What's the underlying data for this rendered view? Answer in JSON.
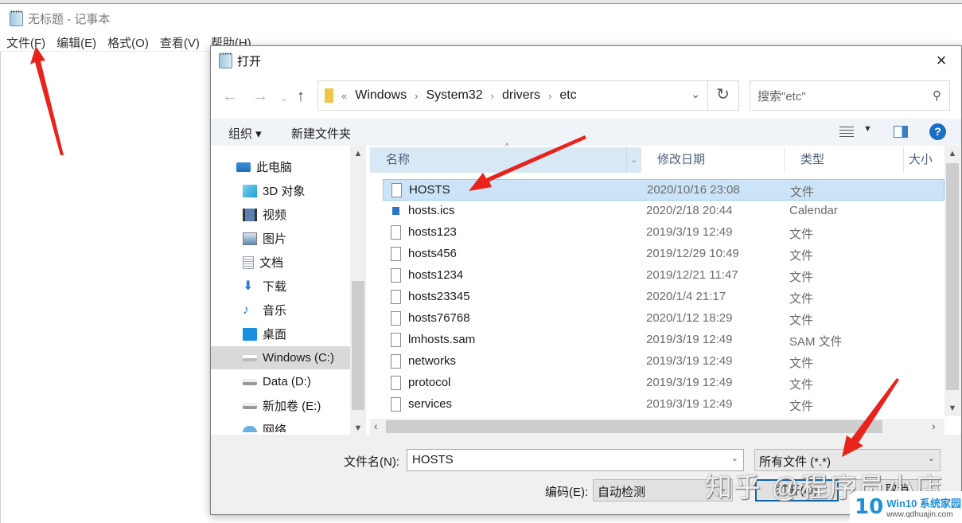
{
  "notepad": {
    "title": "无标题 - 记事本",
    "menu": [
      "文件(F)",
      "编辑(E)",
      "格式(O)",
      "查看(V)",
      "帮助(H)"
    ]
  },
  "dialog": {
    "title": "打开",
    "address": {
      "overflow": "«",
      "crumbs": [
        "Windows",
        "System32",
        "drivers",
        "etc"
      ]
    },
    "search_placeholder": "搜索\"etc\"",
    "toolbar": {
      "organize": "组织 ▾",
      "new_folder": "新建文件夹"
    },
    "nav": [
      {
        "label": "此电脑",
        "icon": "computer-icon"
      },
      {
        "label": "3D 对象",
        "icon": "3d-objects-icon"
      },
      {
        "label": "视频",
        "icon": "video-icon"
      },
      {
        "label": "图片",
        "icon": "pictures-icon"
      },
      {
        "label": "文档",
        "icon": "documents-icon"
      },
      {
        "label": "下载",
        "icon": "download-icon"
      },
      {
        "label": "音乐",
        "icon": "music-icon"
      },
      {
        "label": "桌面",
        "icon": "desktop-icon"
      },
      {
        "label": "Windows (C:)",
        "icon": "drive-c-icon",
        "selected": true
      },
      {
        "label": "Data (D:)",
        "icon": "drive-icon"
      },
      {
        "label": "新加卷 (E:)",
        "icon": "drive-icon"
      },
      {
        "label": "网络",
        "icon": "network-icon"
      }
    ],
    "columns": {
      "name": "名称",
      "date": "修改日期",
      "type": "类型",
      "size": "大小"
    },
    "files": [
      {
        "name": "HOSTS",
        "date": "2020/10/16 23:08",
        "type": "文件",
        "selected": true
      },
      {
        "name": "hosts.ics",
        "date": "2020/2/18 20:44",
        "type": "Calendar",
        "icon": "calendar"
      },
      {
        "name": "hosts123",
        "date": "2019/3/19 12:49",
        "type": "文件"
      },
      {
        "name": "hosts456",
        "date": "2019/12/29 10:49",
        "type": "文件"
      },
      {
        "name": "hosts1234",
        "date": "2019/12/21 11:47",
        "type": "文件"
      },
      {
        "name": "hosts23345",
        "date": "2020/1/4 21:17",
        "type": "文件"
      },
      {
        "name": "hosts76768",
        "date": "2020/1/12 18:29",
        "type": "文件"
      },
      {
        "name": "lmhosts.sam",
        "date": "2019/3/19 12:49",
        "type": "SAM 文件"
      },
      {
        "name": "networks",
        "date": "2019/3/19 12:49",
        "type": "文件"
      },
      {
        "name": "protocol",
        "date": "2019/3/19 12:49",
        "type": "文件"
      },
      {
        "name": "services",
        "date": "2019/3/19 12:49",
        "type": "文件"
      }
    ],
    "filename_label": "文件名(N):",
    "filename_value": "HOSTS",
    "filetype_value": "所有文件  (*.*)",
    "encoding_label": "编码(E):",
    "encoding_value": "自动检测",
    "open_button": "打开(O)",
    "cancel_button": "取消"
  },
  "overlay": {
    "watermark": "知乎 @程序员小店",
    "logo_num": "10",
    "logo_name": "Win10 系统家园",
    "logo_url": "www.qdhuajin.com",
    "arrow_color": "#e8231c"
  }
}
